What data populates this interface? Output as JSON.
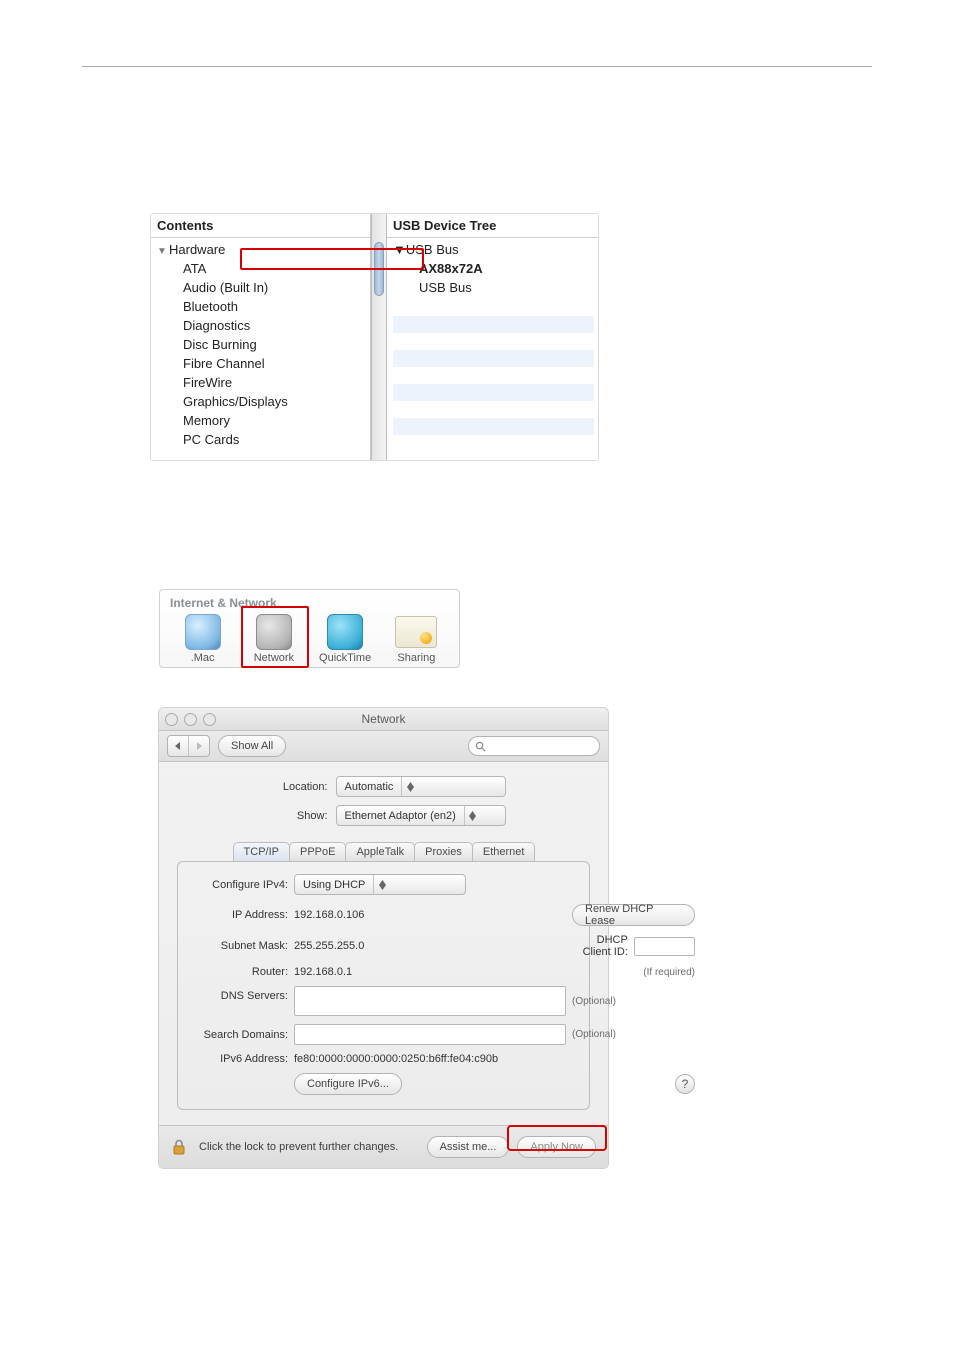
{
  "sys_profiler": {
    "left_header": "Contents",
    "group_label": "Hardware",
    "items": [
      "ATA",
      "Audio (Built In)",
      "Bluetooth",
      "Diagnostics",
      "Disc Burning",
      "Fibre Channel",
      "FireWire",
      "Graphics/Displays",
      "Memory",
      "PC Cards"
    ],
    "right_header": "USB Device Tree",
    "usb_root": "USB Bus",
    "usb_device": "AX88x72A",
    "usb_root2": "USB Bus"
  },
  "prefs_row": {
    "section_title": "Internet & Network",
    "items": [
      {
        "label": ".Mac"
      },
      {
        "label": "Network"
      },
      {
        "label": "QuickTime"
      },
      {
        "label": "Sharing"
      }
    ]
  },
  "network": {
    "window_title": "Network",
    "back_fwd": "◀  ▶",
    "show_all": "Show All",
    "search_placeholder": "",
    "location_label": "Location:",
    "location_value": "Automatic",
    "show_label": "Show:",
    "show_value": "Ethernet Adaptor (en2)",
    "tabs": [
      "TCP/IP",
      "PPPoE",
      "AppleTalk",
      "Proxies",
      "Ethernet"
    ],
    "active_tab": "TCP/IP",
    "configure_label": "Configure IPv4:",
    "configure_value": "Using DHCP",
    "ip_label": "IP Address:",
    "ip_value": "192.168.0.106",
    "renew_button": "Renew DHCP Lease",
    "subnet_label": "Subnet Mask:",
    "subnet_value": "255.255.255.0",
    "dhcpclient_label": "DHCP Client ID:",
    "dhcpclient_hint": "(If required)",
    "router_label": "Router:",
    "router_value": "192.168.0.1",
    "dns_label": "DNS Servers:",
    "dns_hint": "(Optional)",
    "search_label": "Search Domains:",
    "search_hint": "(Optional)",
    "ipv6addr_label": "IPv6 Address:",
    "ipv6addr_value": "fe80:0000:0000:0000:0250:b6ff:fe04:c90b",
    "configure_ipv6_button": "Configure IPv6...",
    "help_glyph": "?",
    "lock_message": "Click the lock to prevent further changes.",
    "assist_button": "Assist me...",
    "apply_button": "Apply Now"
  }
}
